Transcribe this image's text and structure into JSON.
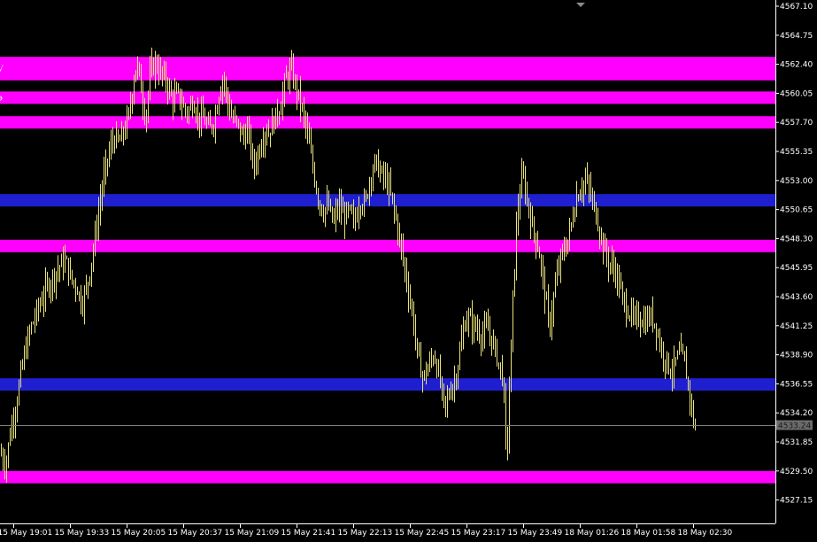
{
  "chart_data": {
    "type": "bar",
    "bar_style": "ohlc",
    "ylim": [
      4526.0,
      4567.1
    ],
    "grid": false,
    "legend": "none",
    "colors": {
      "background": "#000000",
      "bars": "#e9e27a",
      "resistance_zone": "#ff00ff",
      "support_zone": "#1f1fd0",
      "axis": "#ffffff",
      "current_price_line": "#7f7f7f",
      "current_price_box": "#6b6b6b"
    },
    "y_ticks": [
      "4567.10",
      "4564.75",
      "4562.40",
      "4560.05",
      "4557.70",
      "4555.35",
      "4553.00",
      "4550.65",
      "4548.30",
      "4545.95",
      "4543.60",
      "4541.25",
      "4538.90",
      "4536.55",
      "4534.20",
      "4531.85",
      "4529.50",
      "4527.15"
    ],
    "x_ticks": [
      "15 May 19:01",
      "15 May 19:33",
      "15 May 20:05",
      "15 May 20:37",
      "15 May 21:09",
      "15 May 21:41",
      "15 May 22:13",
      "15 May 22:45",
      "15 May 23:17",
      "15 May 23:49",
      "18 May 01:26",
      "18 May 01:58",
      "18 May 02:30"
    ],
    "zones": [
      {
        "kind": "resistance",
        "low": 4561.1,
        "high": 4563.0
      },
      {
        "kind": "resistance",
        "low": 4559.2,
        "high": 4560.2
      },
      {
        "kind": "resistance",
        "low": 4557.2,
        "high": 4558.2
      },
      {
        "kind": "support",
        "low": 4550.9,
        "high": 4551.9
      },
      {
        "kind": "resistance",
        "low": 4547.2,
        "high": 4548.2
      },
      {
        "kind": "support",
        "low": 4536.0,
        "high": 4537.0
      },
      {
        "kind": "resistance",
        "low": 4528.5,
        "high": 4529.5
      }
    ],
    "zone_edge_labels": [
      "√",
      "э"
    ],
    "current_price": 4533.24,
    "current_price_label": "4533.24",
    "close_path": [
      [
        0,
        4531.0
      ],
      [
        6,
        4530.0
      ],
      [
        12,
        4533.0
      ],
      [
        18,
        4535.0
      ],
      [
        26,
        4538.5
      ],
      [
        34,
        4541.0
      ],
      [
        42,
        4542.5
      ],
      [
        50,
        4544.0
      ],
      [
        58,
        4545.0
      ],
      [
        66,
        4546.0
      ],
      [
        74,
        4546.5
      ],
      [
        80,
        4545.0
      ],
      [
        86,
        4544.5
      ],
      [
        92,
        4543.0
      ],
      [
        98,
        4544.5
      ],
      [
        104,
        4547.0
      ],
      [
        110,
        4550.0
      ],
      [
        116,
        4553.0
      ],
      [
        122,
        4555.0
      ],
      [
        128,
        4556.5
      ],
      [
        134,
        4556.0
      ],
      [
        140,
        4557.0
      ],
      [
        146,
        4558.5
      ],
      [
        150,
        4561.0
      ],
      [
        154,
        4562.5
      ],
      [
        158,
        4561.0
      ],
      [
        164,
        4558.0
      ],
      [
        170,
        4562.0
      ],
      [
        176,
        4562.5
      ],
      [
        182,
        4561.5
      ],
      [
        188,
        4561.0
      ],
      [
        194,
        4559.5
      ],
      [
        200,
        4560.0
      ],
      [
        206,
        4559.0
      ],
      [
        212,
        4558.5
      ],
      [
        218,
        4559.5
      ],
      [
        224,
        4558.0
      ],
      [
        230,
        4558.0
      ],
      [
        236,
        4557.0
      ],
      [
        242,
        4558.0
      ],
      [
        248,
        4560.5
      ],
      [
        252,
        4561.5
      ],
      [
        256,
        4559.5
      ],
      [
        262,
        4558.0
      ],
      [
        268,
        4557.5
      ],
      [
        274,
        4556.5
      ],
      [
        280,
        4557.0
      ],
      [
        286,
        4554.0
      ],
      [
        292,
        4555.5
      ],
      [
        298,
        4557.0
      ],
      [
        304,
        4557.0
      ],
      [
        310,
        4558.0
      ],
      [
        316,
        4559.0
      ],
      [
        322,
        4561.0
      ],
      [
        328,
        4562.0
      ],
      [
        334,
        4560.5
      ],
      [
        340,
        4559.0
      ],
      [
        346,
        4557.0
      ],
      [
        352,
        4554.5
      ],
      [
        358,
        4552.0
      ],
      [
        364,
        4550.5
      ],
      [
        370,
        4551.0
      ],
      [
        376,
        4549.5
      ],
      [
        382,
        4551.0
      ],
      [
        388,
        4550.0
      ],
      [
        394,
        4550.5
      ],
      [
        400,
        4549.5
      ],
      [
        406,
        4551.5
      ],
      [
        412,
        4551.0
      ],
      [
        418,
        4553.5
      ],
      [
        424,
        4554.5
      ],
      [
        430,
        4553.5
      ],
      [
        436,
        4553.0
      ],
      [
        442,
        4551.5
      ],
      [
        448,
        4549.5
      ],
      [
        454,
        4547.0
      ],
      [
        460,
        4544.5
      ],
      [
        466,
        4542.0
      ],
      [
        472,
        4538.5
      ],
      [
        478,
        4537.0
      ],
      [
        484,
        4538.0
      ],
      [
        490,
        4539.0
      ],
      [
        496,
        4537.0
      ],
      [
        502,
        4534.5
      ],
      [
        508,
        4536.0
      ],
      [
        514,
        4537.0
      ],
      [
        520,
        4539.5
      ],
      [
        526,
        4542.0
      ],
      [
        532,
        4541.5
      ],
      [
        538,
        4541.0
      ],
      [
        544,
        4540.5
      ],
      [
        550,
        4541.0
      ],
      [
        556,
        4540.0
      ],
      [
        562,
        4538.5
      ],
      [
        568,
        4537.0
      ],
      [
        572,
        4530.0
      ],
      [
        575,
        4536.0
      ],
      [
        580,
        4545.0
      ],
      [
        584,
        4550.5
      ],
      [
        590,
        4553.5
      ],
      [
        596,
        4551.0
      ],
      [
        602,
        4549.0
      ],
      [
        608,
        4547.5
      ],
      [
        614,
        4544.5
      ],
      [
        620,
        4541.0
      ],
      [
        626,
        4544.0
      ],
      [
        632,
        4546.5
      ],
      [
        638,
        4547.5
      ],
      [
        644,
        4549.0
      ],
      [
        650,
        4551.5
      ],
      [
        656,
        4552.5
      ],
      [
        662,
        4553.0
      ],
      [
        668,
        4551.5
      ],
      [
        674,
        4550.0
      ],
      [
        680,
        4548.0
      ],
      [
        686,
        4546.5
      ],
      [
        692,
        4546.0
      ],
      [
        698,
        4545.0
      ],
      [
        704,
        4543.0
      ],
      [
        710,
        4542.5
      ],
      [
        716,
        4541.5
      ],
      [
        722,
        4542.0
      ],
      [
        728,
        4541.5
      ],
      [
        734,
        4542.0
      ],
      [
        740,
        4541.5
      ],
      [
        746,
        4539.5
      ],
      [
        752,
        4538.5
      ],
      [
        758,
        4537.5
      ],
      [
        764,
        4538.5
      ],
      [
        770,
        4539.0
      ],
      [
        776,
        4537.0
      ],
      [
        782,
        4534.0
      ],
      [
        786,
        4532.5
      ]
    ]
  }
}
